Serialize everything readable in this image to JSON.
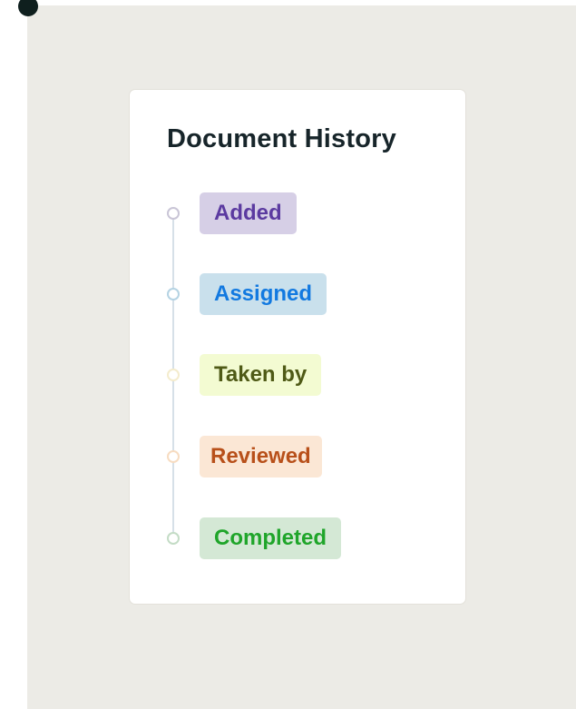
{
  "history": {
    "title": "Document History",
    "events": [
      {
        "label": "Added",
        "text_color": "#5b3aa0",
        "badge_color": "#d6cfe6",
        "node_color": "#c9c5d6"
      },
      {
        "label": "Assigned",
        "text_color": "#1279e0",
        "badge_color": "#c9e0ec",
        "node_color": "#b5d3e3"
      },
      {
        "label": "Taken by",
        "text_color": "#4f5a16",
        "badge_color": "#f3fbd2",
        "node_color": "#f4eccd"
      },
      {
        "label": "Reviewed",
        "text_color": "#b8501a",
        "badge_color": "#fbe7d5",
        "node_color": "#f7dcc1"
      },
      {
        "label": "Completed",
        "text_color": "#1fa52a",
        "badge_color": "#d4e8d5",
        "node_color": "#c4dcc6"
      }
    ]
  }
}
